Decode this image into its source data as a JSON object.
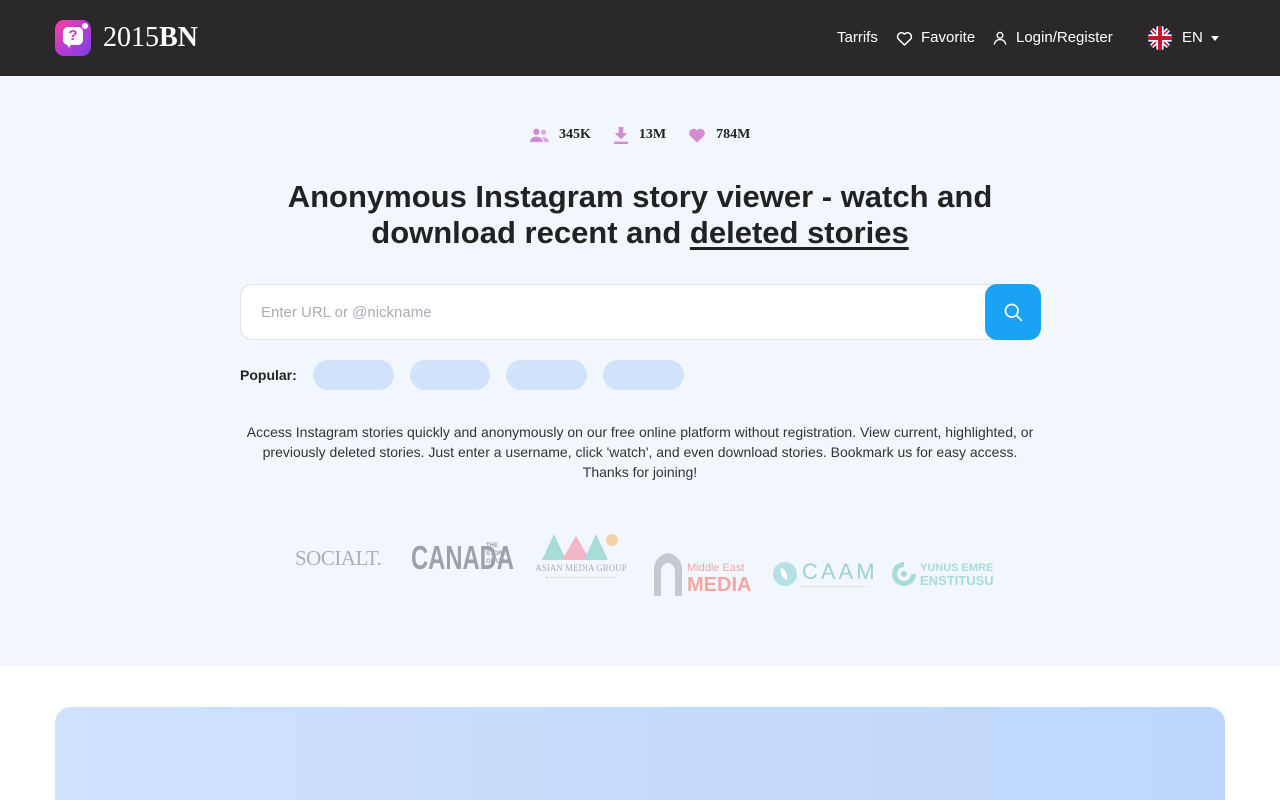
{
  "header": {
    "brand_light": "2015",
    "brand_bold": "BN",
    "nav": {
      "tarrifs": "Tarrifs",
      "favorite": "Favorite",
      "login": "Login/Register",
      "language": "EN"
    }
  },
  "stats": [
    {
      "icon": "users-icon",
      "value": "345K"
    },
    {
      "icon": "download-icon",
      "value": "13M"
    },
    {
      "icon": "heart-icon",
      "value": "784M"
    }
  ],
  "hero": {
    "title_bold": "Anonymous Instagram story viewer",
    "title_rest": " - watch and download recent and ",
    "title_link": "deleted stories",
    "search_placeholder": "Enter URL or @nickname",
    "popular_label": "Popular:",
    "description": "Access Instagram stories quickly and anonymously on our free online platform without registration. View current, highlighted, or previously deleted stories. Just enter a username, click 'watch', and even download stories. Bookmark us for easy access. Thanks for joining!"
  },
  "partner_logos": {
    "social": "SOCIALT.",
    "canada_main": "CANADA",
    "canada_side": "THE STORY OF US",
    "amg_main": "ASIAN MEDIA GROUP",
    "me_small": "Middle East",
    "me_big": "MEDIA",
    "caam": "CAAM",
    "yunus_top": "YUNUS EMRE",
    "yunus_bottom": "ENSTITUSU"
  },
  "colors": {
    "header_bg": "#2a2828",
    "hero_bg": "#f2f7fe",
    "accent": "#1aa3f5",
    "stat_icon": "#d58bd0"
  }
}
